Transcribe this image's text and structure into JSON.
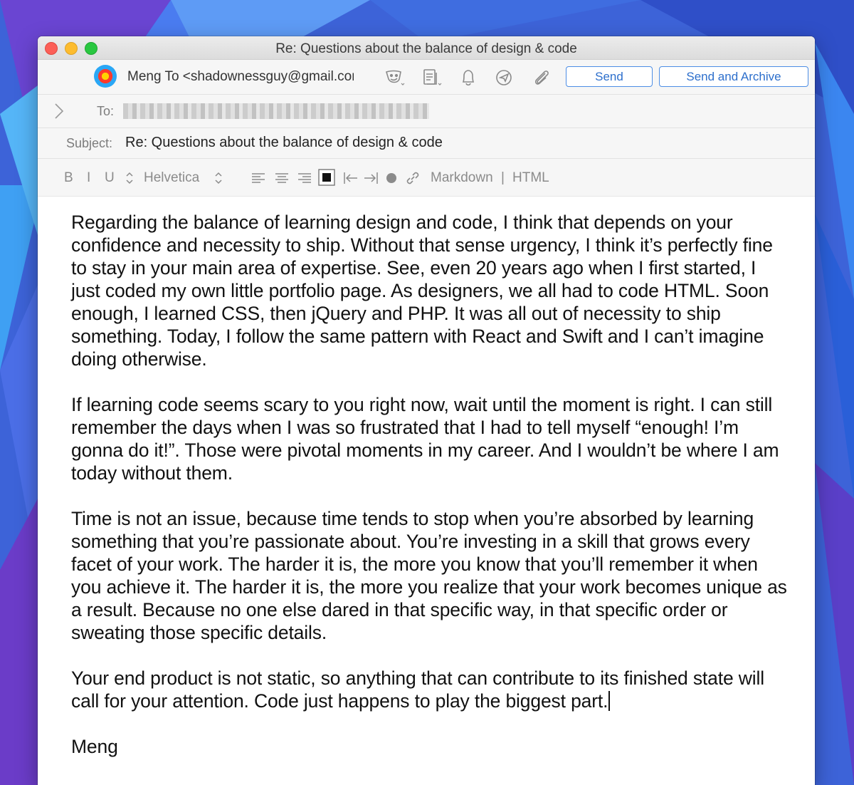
{
  "window": {
    "title": "Re: Questions about the balance of design & code"
  },
  "toolbar": {
    "from": "Meng To <shadownessguy@gmail.com>",
    "send_label": "Send",
    "send_archive_label": "Send and Archive",
    "icons": [
      "signature-icon",
      "template-icon",
      "bell-icon",
      "send-later-icon",
      "attachment-icon"
    ]
  },
  "headers": {
    "to_label": "To:",
    "subject_label": "Subject:",
    "subject_value": "Re: Questions about the balance of design & code"
  },
  "format": {
    "bold": "B",
    "italic": "I",
    "underline": "U",
    "font": "Helvetica",
    "markdown": "Markdown",
    "separator": "|",
    "html": "HTML"
  },
  "body": {
    "paragraphs": [
      "Regarding the balance of learning design and code, I think that depends on your confidence and necessity to ship. Without that sense urgency, I think it’s perfectly fine to stay in your main area of expertise. See, even 20 years ago when I first started, I just coded my own little portfolio page. As designers, we all had to code HTML. Soon enough, I learned CSS, then jQuery and PHP. It was all out of necessity to ship something. Today, I follow the same pattern with React and Swift and I can’t imagine doing otherwise.",
      "If learning code seems scary to you right now, wait until the moment is right. I can still remember the days when I was so frustrated that I had to tell myself “enough! I’m gonna do it!”. Those were pivotal moments in my career. And I wouldn’t be where I am today without them.",
      "Time is not an issue, because time tends to stop when you’re absorbed by learning something that you’re passionate about. You’re investing in a skill that grows every facet of your work. The harder it is, the more you know that you’ll remember it when you achieve it. The harder it is, the more you realize that your work becomes unique as a result. Because no one else dared in that specific way, in that specific order or sweating those specific details.",
      "Your end product is not static, so anything that can contribute to its finished state will call for your attention. Code just happens to play the biggest part."
    ],
    "signature": "Meng"
  },
  "colors": {
    "accent": "#2d6fcc",
    "close": "#fc5f57",
    "minimize": "#fdbc2e",
    "maximize": "#29c740"
  }
}
